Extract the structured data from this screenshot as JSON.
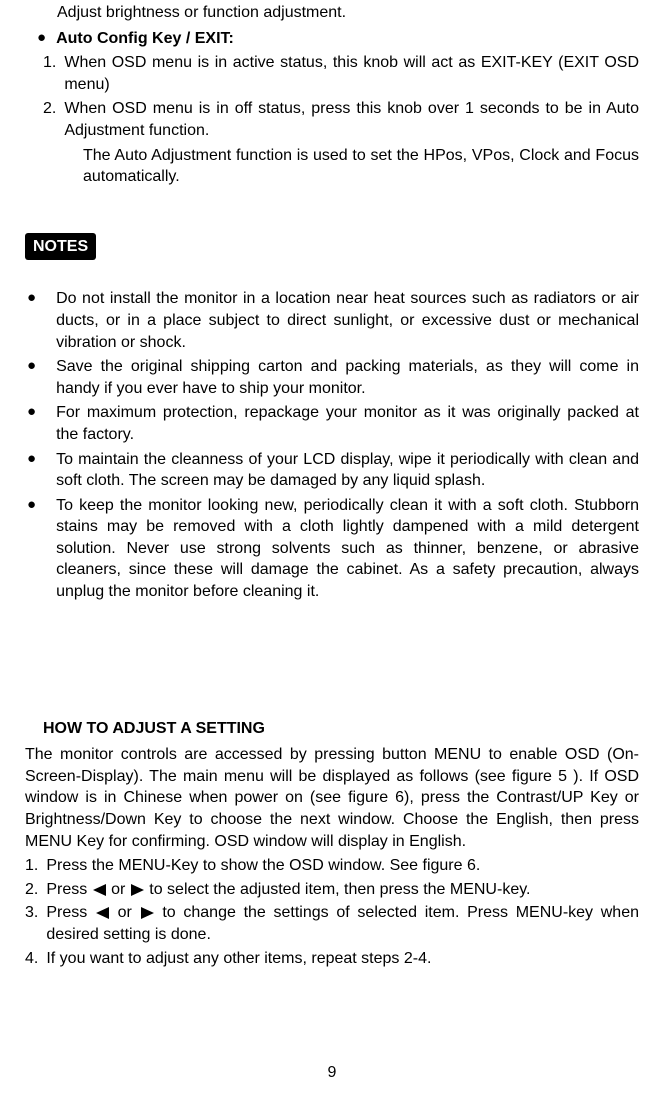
{
  "intro": {
    "line1": "Adjust brightness or function adjustment.",
    "autoHeading": "Auto Config Key / EXIT:",
    "autoItems": [
      {
        "num": "1.",
        "text": "When OSD menu is in active status, this knob will act as EXIT-KEY (EXIT OSD menu)"
      },
      {
        "num": "2.",
        "text1": "When OSD menu is in off status, press this knob over 1 seconds to  be in Auto Adjustment function.",
        "text2": "The Auto Adjustment function is used to set the HPos, VPos, Clock and Focus automatically."
      }
    ]
  },
  "notesLabel": "NOTES",
  "notes": [
    "Do not install the monitor in a location near heat sources such as radiators or air ducts, or in a place subject to direct sunlight, or excessive dust or mechanical vibration or shock.",
    "Save the original shipping carton and packing materials, as they will come in handy if you ever have to ship your monitor.",
    "For maximum protection, repackage your monitor as it was originally packed at the factory.",
    "To maintain the cleanness of your LCD display, wipe it periodically with clean and soft cloth. The screen may be damaged by any liquid splash.",
    "To keep the monitor looking new, periodically clean it with a soft cloth. Stubborn stains may be removed with a cloth lightly dampened with a mild detergent solution. Never use strong solvents such as thinner, benzene, or abrasive cleaners, since these will damage the cabinet. As a safety precaution, always unplug the monitor before cleaning it."
  ],
  "howto": {
    "heading": "HOW TO ADJUST A SETTING",
    "intro": "The monitor controls are accessed by pressing button MENU to enable OSD (On-Screen-Display). The main menu will be displayed as follows (see figure 5 ). If OSD window is in Chinese when power on (see figure 6),  press the Contrast/UP Key or Brightness/Down Key to choose the next window. Choose the English, then press MENU Key for confirming. OSD window will display in English.",
    "steps": [
      {
        "num": "1.",
        "text": "Press the MENU-Key to show the OSD window. See figure 6."
      },
      {
        "num": "2.",
        "pre": "Press ",
        "mid": " or ",
        "post": " to select the adjusted item, then press the MENU-key."
      },
      {
        "num": "3.",
        "pre": "Press ",
        "mid": " or ",
        "post": " to change the settings of selected item. Press MENU-key when desired setting is done."
      },
      {
        "num": "4.",
        "text": "If you want to adjust any other items, repeat steps 2-4."
      }
    ]
  },
  "pageNumber": "9"
}
